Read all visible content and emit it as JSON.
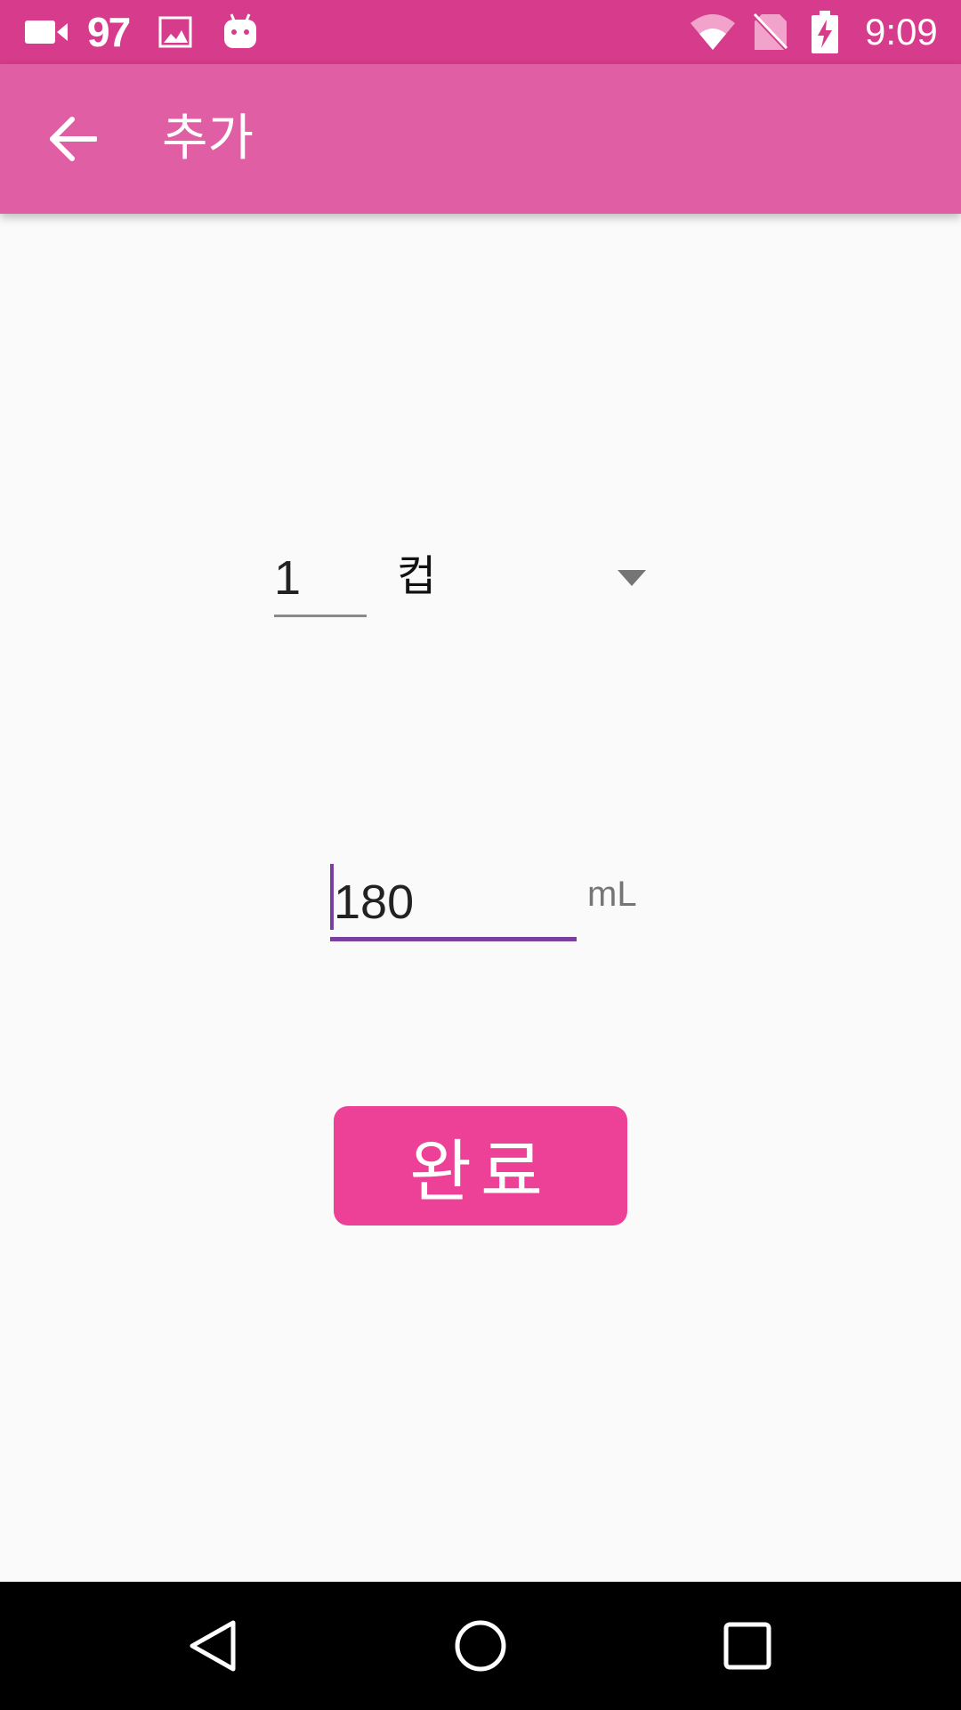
{
  "status_bar": {
    "notification_count": "97",
    "time": "9:09",
    "icons": [
      "video-camera-icon",
      "image-icon",
      "android-icon",
      "wifi-icon",
      "no-sim-icon",
      "battery-charging-icon"
    ]
  },
  "app_bar": {
    "title": "추가",
    "back_icon": "arrow-back-icon"
  },
  "form": {
    "quantity_value": "1",
    "unit_selected": "컵",
    "volume_value": "180",
    "volume_unit": "mL"
  },
  "actions": {
    "done_label": "완료"
  },
  "colors": {
    "status_bar": "#d63c8b",
    "app_bar": "#df5ea4",
    "accent": "#7b3fa0",
    "button": "#ec4196"
  },
  "nav_bar": {
    "buttons": [
      "back-triangle-icon",
      "home-circle-icon",
      "recents-square-icon"
    ]
  }
}
